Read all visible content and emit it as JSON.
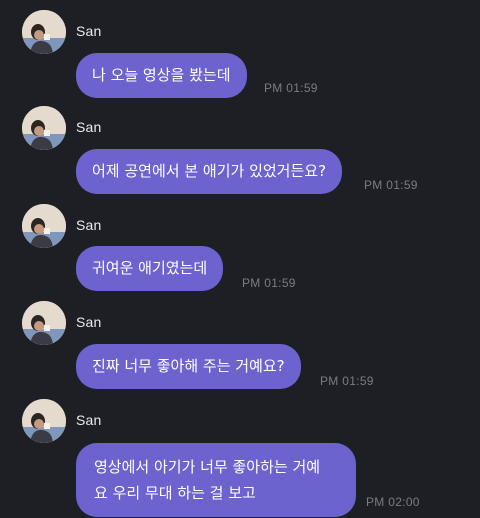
{
  "messages": [
    {
      "sender": "San",
      "text": "나 오늘 영상을 봤는데",
      "time": "PM 01:59"
    },
    {
      "sender": "San",
      "text": "어제 공연에서 본 애기가 있었거든요?",
      "time": "PM 01:59"
    },
    {
      "sender": "San",
      "text": "귀여운 애기였는데",
      "time": "PM 01:59"
    },
    {
      "sender": "San",
      "text": "진짜 너무 좋아해 주는 거예요?",
      "time": "PM 01:59"
    },
    {
      "sender": "San",
      "text_line1": "영상에서 아기가 너무 좋아하는 거예",
      "text_line2": "요 우리 무대 하는 걸 보고",
      "time": "PM 02:00"
    }
  ],
  "colors": {
    "background": "#1e1e25",
    "bubble": "#6c63cf",
    "sender_text": "#e9e9ef",
    "time_text": "#7b7b86"
  },
  "icons": {
    "avatar": "profile-photo-avatar"
  }
}
